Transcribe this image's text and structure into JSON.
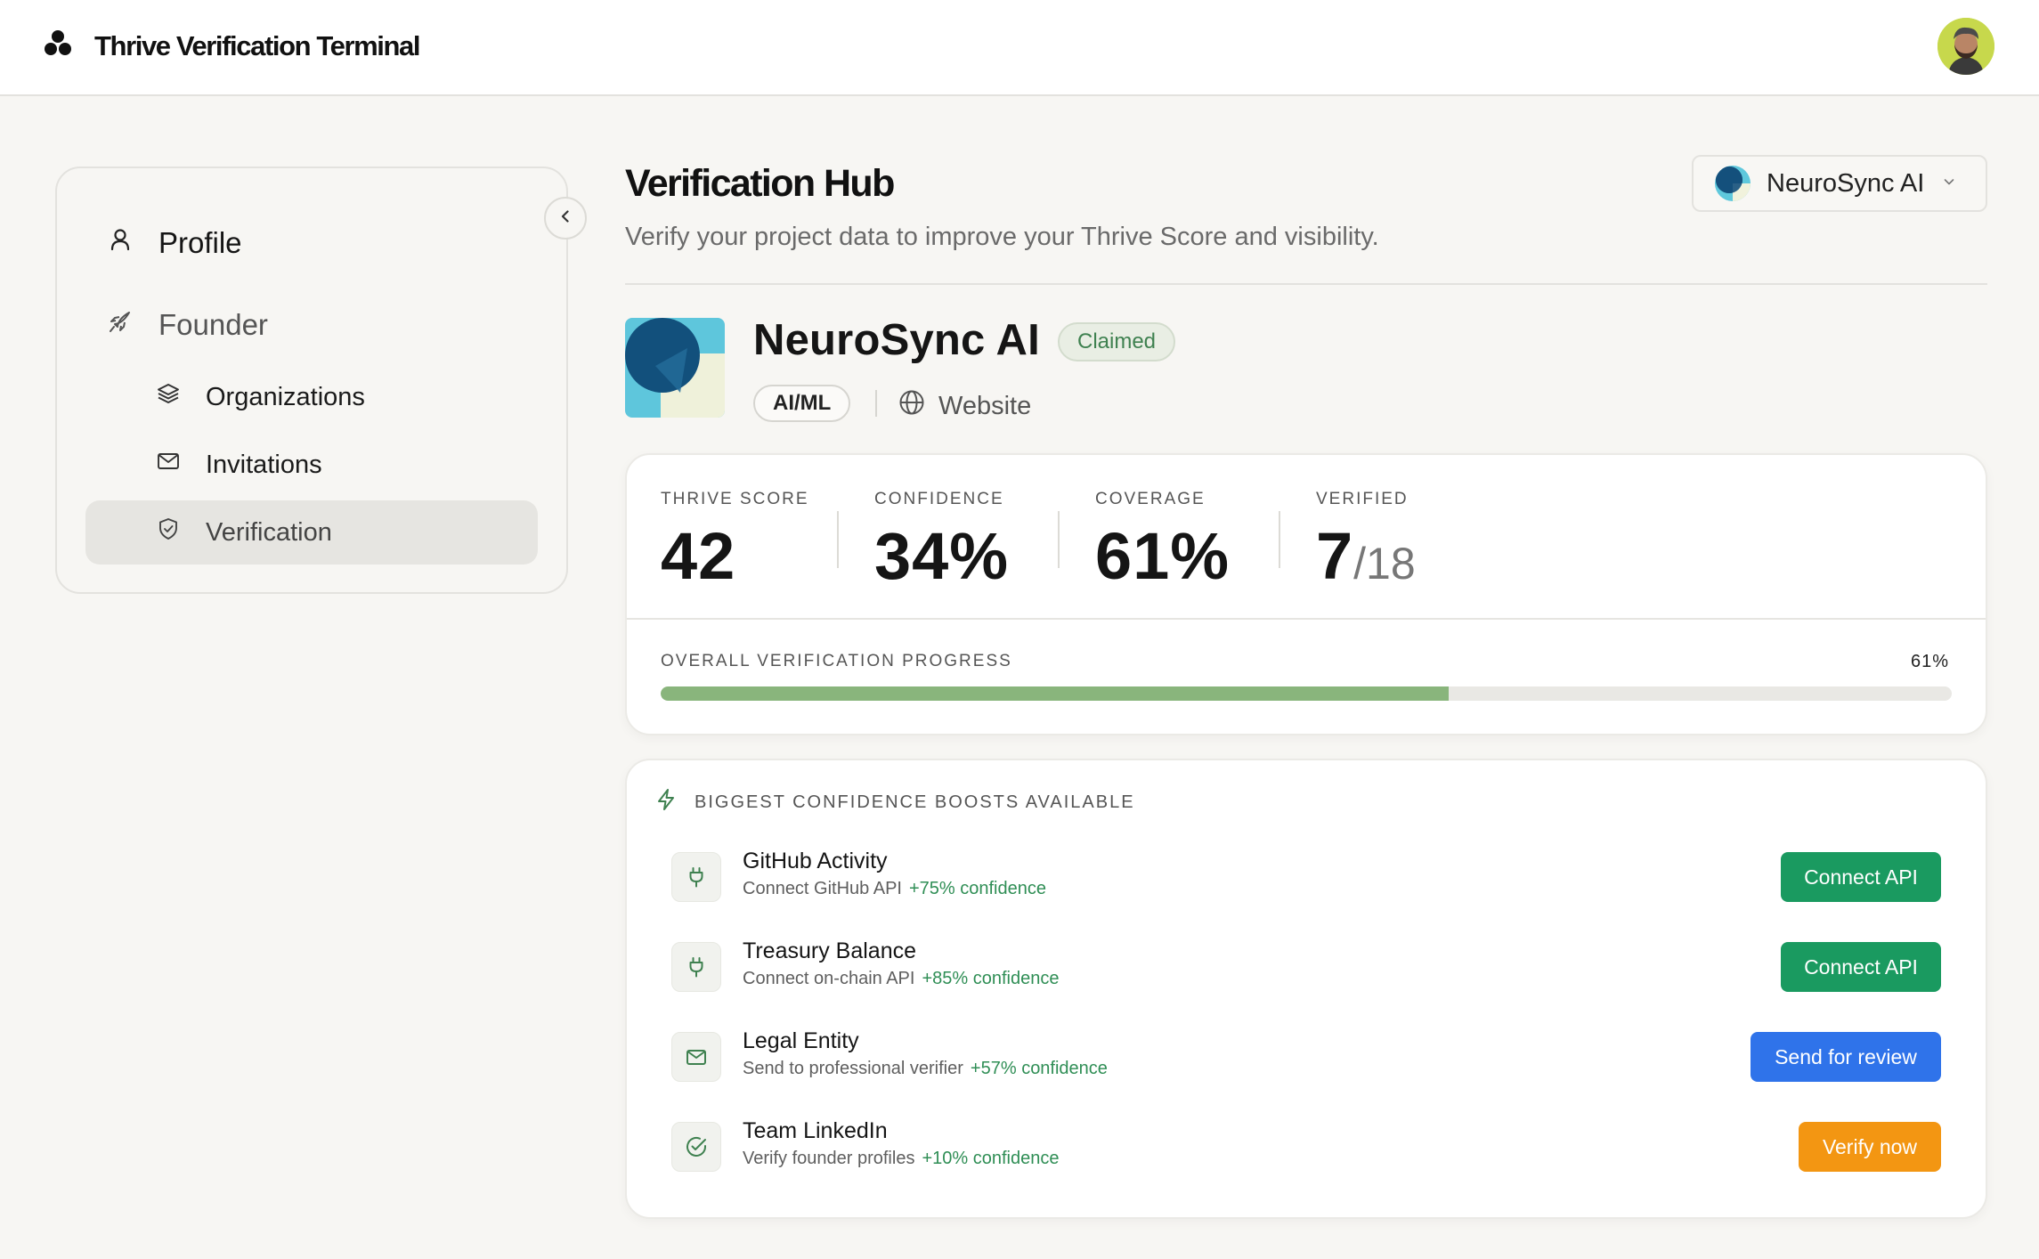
{
  "app": {
    "title": "Thrive Verification Terminal"
  },
  "sidebar": {
    "items": [
      {
        "label": "Profile"
      },
      {
        "label": "Founder"
      },
      {
        "label": "Organizations"
      },
      {
        "label": "Invitations"
      },
      {
        "label": "Verification",
        "active": true
      }
    ]
  },
  "header": {
    "title": "Verification Hub",
    "subtitle": "Verify your project data to improve your Thrive Score and visibility.",
    "project_selector": "NeuroSync AI"
  },
  "project": {
    "name": "NeuroSync AI",
    "status_badge": "Claimed",
    "category": "AI/ML",
    "website_label": "Website"
  },
  "stats": {
    "thrive_score_label": "THRIVE SCORE",
    "thrive_score": "42",
    "confidence_label": "CONFIDENCE",
    "confidence": "34%",
    "coverage_label": "COVERAGE",
    "coverage": "61%",
    "verified_label": "VERIFIED",
    "verified": "7",
    "verified_total": "/18"
  },
  "progress": {
    "label": "OVERALL VERIFICATION PROGRESS",
    "percent_text": "61%",
    "value": 0.61,
    "color": "#89b57c"
  },
  "boosts": {
    "title": "BIGGEST CONFIDENCE BOOSTS AVAILABLE",
    "items": [
      {
        "name": "GitHub Activity",
        "desc": "Connect GitHub API",
        "confidence": "+75% confidence",
        "action": "Connect API",
        "icon": "plug-icon",
        "color": "#1a9a60"
      },
      {
        "name": "Treasury Balance",
        "desc": "Connect on-chain API",
        "confidence": "+85% confidence",
        "action": "Connect API",
        "icon": "plug-icon",
        "color": "#1a9a60"
      },
      {
        "name": "Legal Entity",
        "desc": "Send to professional verifier",
        "confidence": "+57% confidence",
        "action": "Send for review",
        "icon": "mail-icon",
        "color": "#2f73ea"
      },
      {
        "name": "Team LinkedIn",
        "desc": "Verify founder profiles",
        "confidence": "+10% confidence",
        "action": "Verify now",
        "icon": "check-circle-icon",
        "color": "#f39612"
      }
    ]
  }
}
